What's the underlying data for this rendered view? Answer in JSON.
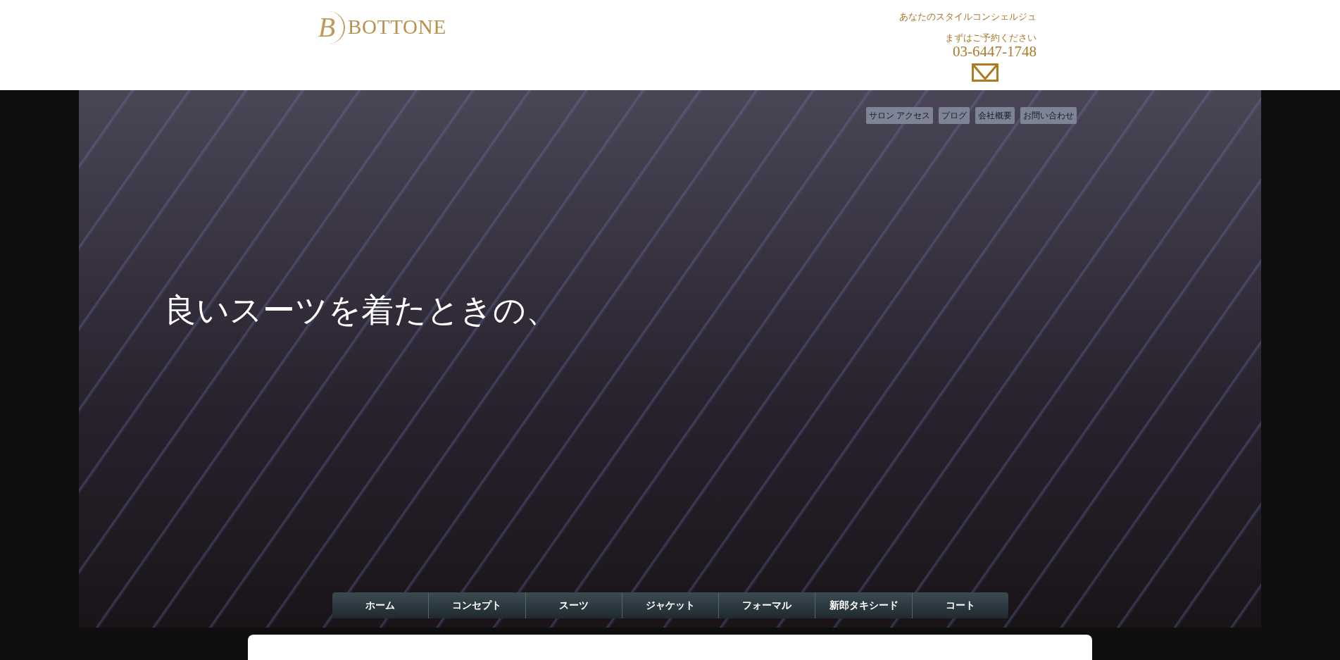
{
  "header": {
    "logo_monogram": "B",
    "logo_text": "BOTTONE",
    "tagline": "あなたのスタイルコンシェルジュ",
    "reservation_label": "まずはご予約ください",
    "phone": "03-6447-1748"
  },
  "top_links": [
    {
      "label": "サロン アクセス"
    },
    {
      "label": "ブログ"
    },
    {
      "label": "会社概要"
    },
    {
      "label": "お問い合わせ"
    }
  ],
  "hero": {
    "caption": "良いスーツを着たときの、"
  },
  "nav": [
    {
      "label": "ホーム"
    },
    {
      "label": "コンセプト"
    },
    {
      "label": "スーツ"
    },
    {
      "label": "ジャケット"
    },
    {
      "label": "フォーマル"
    },
    {
      "label": "新郎タキシード"
    },
    {
      "label": "コート"
    }
  ]
}
